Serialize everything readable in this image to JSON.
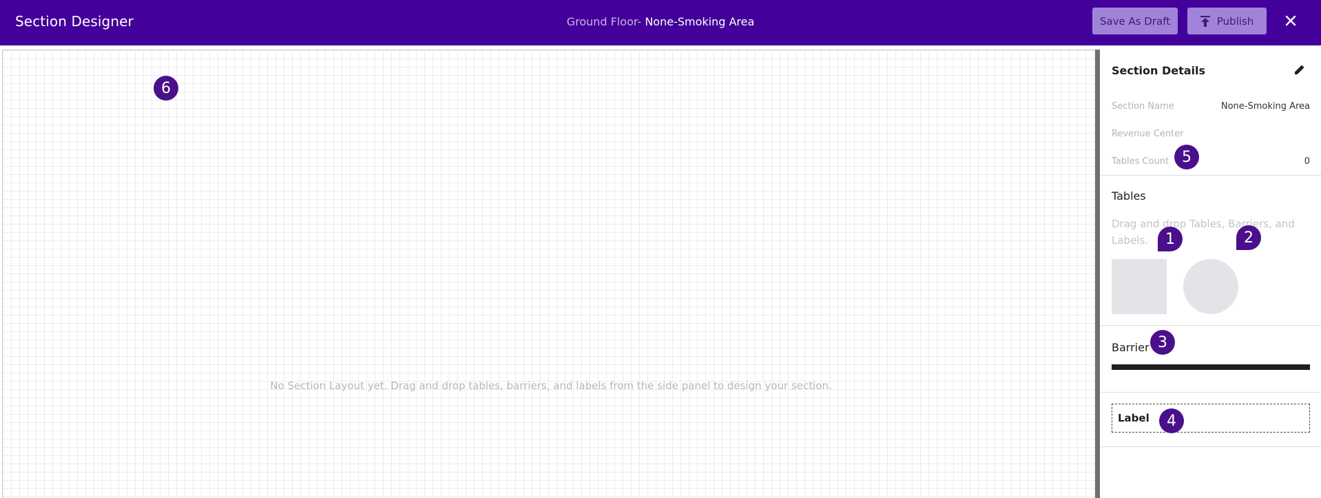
{
  "header": {
    "title": "Section Designer",
    "breadcrumb_floor": "Ground Floor-",
    "breadcrumb_area": "None-Smoking Area",
    "save_draft_label": "Save As Draft",
    "publish_label": "Publish",
    "publish_icon": "upload-icon",
    "close_icon": "close-icon",
    "background_color": "#44009a",
    "button_color": "#a184d9"
  },
  "canvas": {
    "empty_message": "No Section Layout yet. Drag and drop tables, barriers, and labels from the side panel to design your section."
  },
  "details": {
    "title": "Section Details",
    "edit_icon": "pencil-icon",
    "section_name_label": "Section Name",
    "section_name_value": "None-Smoking Area",
    "revenue_center_label": "Revenue Center",
    "revenue_center_value": "",
    "tables_count_label": "Tables Count",
    "tables_count_value": "0"
  },
  "tables": {
    "title": "Tables",
    "hint": "Drag and drop Tables, Barriers, and Labels.",
    "shapes": [
      "square-table",
      "round-table"
    ]
  },
  "barrier": {
    "title": "Barrier"
  },
  "label": {
    "text": "Label"
  },
  "markers": {
    "m1": "1",
    "m2": "2",
    "m3": "3",
    "m4": "4",
    "m5": "5",
    "m6": "6",
    "color": "#4a0f8a"
  }
}
